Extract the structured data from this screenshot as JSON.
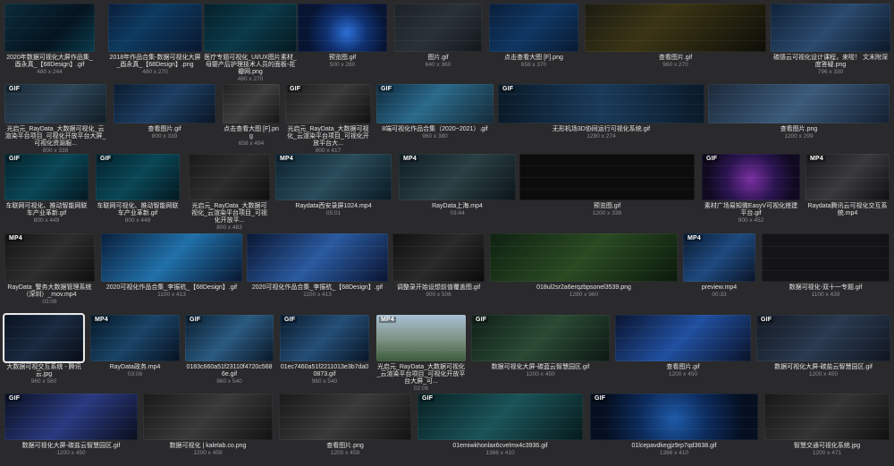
{
  "files": [
    {
      "id": "r1c1",
      "name": "2020年数据可视化大屏作品集_酉永真_【68Design】.gif",
      "dims": "480 x 244",
      "tag": "",
      "bg": "linear-gradient(135deg,#0b2b3b 0%,#05141f 60%,#0a3b4c 100%)"
    },
    {
      "id": "r1c2",
      "name": "2018年作品合集-数据可视化大屏_酉永真_【68Design】.png",
      "dims": "480 x 270",
      "tag": "",
      "bg": "linear-gradient(135deg,#0b1d3b 0%,#0d3b60 40%,#0a1730 100%)"
    },
    {
      "id": "r1c3",
      "name": "医疗专题可视化_UI/UX图片素材_母婴产后护理技术人员的面板-花瓣网.png",
      "dims": "480 x 270",
      "tag": "",
      "bg": "linear-gradient(135deg,#05202a 0%,#0b3a4a 50%,#041920 100%)"
    },
    {
      "id": "r1c4",
      "name": "预览图.gif",
      "dims": "500 x 280",
      "tag": "",
      "bg": "radial-gradient(circle at 55% 60%,#2b6fd6 0%,#103070 35%,#071432 70%)"
    },
    {
      "id": "r1c5",
      "name": "图片.gif",
      "dims": "640 x 360",
      "tag": "",
      "bg": "linear-gradient(135deg,#1c2228 0%,#2a3138 50%,#13181c 100%)"
    },
    {
      "id": "r1c6",
      "name": "点击查看大图 [F].png",
      "dims": "658 x 370",
      "tag": "",
      "bg": "linear-gradient(135deg,#0a1f3a 0%,#0f3763 50%,#081a31 100%)"
    },
    {
      "id": "r1c7",
      "name": "查看图片.gif",
      "dims": "960 x 270",
      "tag": "",
      "bg": "linear-gradient(135deg,#1b1b12 0%,#3b3515 40%,#0e0e08 100%)"
    },
    {
      "id": "r1c8",
      "name": "碳感云可视化设计课程，来啦！ 文末附深度答疑.png",
      "dims": "796 x 330",
      "tag": "",
      "bg": "linear-gradient(135deg,#0f2238 0%,#2b4a6e 50%,#0b1828 100%)"
    },
    {
      "id": "r2c1",
      "name": "光启元_RayData_大数据可视化_云渲染平台项目_可视化开放平台大屏_可视化资源服...",
      "dims": "800 x 338",
      "tag": "GIF",
      "bg": "linear-gradient(135deg,#1a2a36 0%,#2d4658 50%,#111c24 100%)"
    },
    {
      "id": "r2c2",
      "name": "查看图片.gif",
      "dims": "800 x 339",
      "tag": "",
      "bg": "linear-gradient(135deg,#0a1c2e 0%,#1d3e63 50%,#0a1523 100%)"
    },
    {
      "id": "r2c3",
      "name": "点击查看大图 [F].png",
      "dims": "658 x 494",
      "tag": "",
      "bg": "linear-gradient(135deg,#222 0%,#3e3e3e 50%,#151515 100%)"
    },
    {
      "id": "r2c4",
      "name": "光启元_RayData_大数据可视化_云渲染平台项目_可视化开放平台大...",
      "dims": "800 x 417",
      "tag": "GIF",
      "bg": "linear-gradient(135deg,#1e1e1e 0%,#3a3a3a 50%,#101010 100%)"
    },
    {
      "id": "r2c5",
      "name": "8端可视化作品合集（2020~2021）.gif",
      "dims": "960 x 380",
      "tag": "GIF",
      "bg": "linear-gradient(135deg,#0f2a3e 0%,#2a6a8a 45%,#152a38 100%)"
    },
    {
      "id": "r2c6",
      "name": "无形机场3D协同运行可视化系统.gif",
      "dims": "1290 x 274",
      "tag": "GIF",
      "bg": "linear-gradient(90deg,#0a1a28 0%,#1a3a5a 50%,#0a1a28 100%)"
    },
    {
      "id": "r2c7",
      "name": "查看图片.png",
      "dims": "1200 x 299",
      "tag": "",
      "bg": "linear-gradient(135deg,#1c2a3a 0%,#3b5a7a 50%,#142030 100%)"
    },
    {
      "id": "r3c1",
      "name": "车联网可视化、推动智能网联车产业革新.gif",
      "dims": "800 x 449",
      "tag": "GIF",
      "bg": "linear-gradient(135deg,#03222c 0%,#0a4756 50%,#031820 100%)"
    },
    {
      "id": "r3c2",
      "name": "车联网可视化、推动智能网联车产业革新.gif",
      "dims": "800 x 449",
      "tag": "GIF",
      "bg": "linear-gradient(135deg,#03222c 0%,#0a4756 50%,#031820 100%)"
    },
    {
      "id": "r3c3",
      "name": "光启元_RayData_大数据可视化_云渲染平台项目_可视化开放平...",
      "dims": "800 x 483",
      "tag": "",
      "bg": "linear-gradient(135deg,#1a1a1a 0%,#2d2d2d 50%,#0e0e0e 100%)"
    },
    {
      "id": "r3c4",
      "name": "Raydata西安录屏1024.mp4",
      "dims": "05:01",
      "tag": "MP4",
      "bg": "linear-gradient(135deg,#0c2230 0%,#2a4c5a 50%,#0a1a24 100%)"
    },
    {
      "id": "r3c5",
      "name": "RayData上海.mp4",
      "dims": "03:44",
      "tag": "MP4",
      "bg": "linear-gradient(135deg,#101e26 0%,#2a4044 50%,#0c1418 100%)"
    },
    {
      "id": "r3c6",
      "name": "预览图.gif",
      "dims": "1200 x 338",
      "tag": "",
      "bg": "#0c0c0c"
    },
    {
      "id": "r3c7",
      "name": "素材广场易知微EasyV可视化搭建平台.gif",
      "dims": "900 x 452",
      "tag": "GIF",
      "bg": "radial-gradient(circle at 50% 55%,#7a2fa0 0%,#2a1450 45%,#0f0a20 80%)"
    },
    {
      "id": "r3c8",
      "name": "Raydata腾讯云可视化交互系统.mp4",
      "dims": "",
      "tag": "MP4",
      "bg": "linear-gradient(135deg,#1a1a1c 0%,#3a3a3e 50%,#101012 100%)"
    },
    {
      "id": "r4c1",
      "name": "RayData_警务大数据管理系统（深圳）_mov.mp4",
      "dims": "03:08",
      "tag": "MP4",
      "bg": "linear-gradient(135deg,#141414 0%,#2e2e2e 50%,#0e0e0e 100%)"
    },
    {
      "id": "r4c2",
      "name": "2020可视化作品合集_李振杭_【68Design】.gif",
      "dims": "1100 x 413",
      "tag": "",
      "bg": "linear-gradient(135deg,#0a1e3a 0%,#2070a8 50%,#0a1630 100%)"
    },
    {
      "id": "r4c3",
      "name": "2020可视化作品合集_李振杭_【68Design】.gif",
      "dims": "1100 x 413",
      "tag": "",
      "bg": "linear-gradient(135deg,#0a1630 0%,#2a5aa0 50%,#0a1430 100%)"
    },
    {
      "id": "r4c4",
      "name": "调整录开始设想前值覆盖图.gif",
      "dims": "900 x 506",
      "tag": "",
      "bg": "linear-gradient(135deg,#111 0%,#2a2a2a 50%,#0a0a0a 100%)"
    },
    {
      "id": "r4c5",
      "name": "018ul2sr2a6erqzbpsonel3539.png",
      "dims": "1280 x 960",
      "tag": "",
      "bg": "linear-gradient(135deg,#0f2212 0%,#2a4a22 50%,#0c1a0c 100%)"
    },
    {
      "id": "r4c6",
      "name": "preview.mp4",
      "dims": "00:33",
      "tag": "MP4",
      "bg": "linear-gradient(135deg,#0a1a30 0%,#1e4a80 50%,#0a1428 100%)"
    },
    {
      "id": "r4c7",
      "name": "数据可视化-双十一专题.gif",
      "dims": "1100 x 439",
      "tag": "",
      "bg": "#141416"
    },
    {
      "id": "r5c1",
      "name": "大数据可视交互系统 - 腾讯云.jpg",
      "dims": "960 x 560",
      "tag": "",
      "bg": "linear-gradient(135deg,#0a1220 0%,#1a2a40 50%,#080e18 100%)",
      "selected": true
    },
    {
      "id": "r5c2",
      "name": "RayData政务.mp4",
      "dims": "03:08",
      "tag": "MP4",
      "bg": "linear-gradient(135deg,#061828 0%,#1a4468 50%,#061220 100%)"
    },
    {
      "id": "r5c3",
      "name": "0183c660a51f23110f4720c5686e.gif",
      "dims": "960 x 540",
      "tag": "GIF",
      "bg": "linear-gradient(135deg,#0a1e30 0%,#2a5a80 50%,#0a1828 100%)"
    },
    {
      "id": "r5c4",
      "name": "01ec7460a51f2211013e3b7da00873.gif",
      "dims": "960 x 540",
      "tag": "GIF",
      "bg": "linear-gradient(135deg,#0a1c2e 0%,#244e76 50%,#081626 100%)"
    },
    {
      "id": "r5c5",
      "name": "光启元_RayData_大数据可视化_云渲染平台项目_可视化开放平台大屏_可...",
      "dims": "02:06",
      "tag": "MP4",
      "bg": "linear-gradient(180deg,#a8c0d4 0%,#7a9080 55%,#3a5a3a 100%)"
    },
    {
      "id": "r5c6",
      "name": "数据可视化大屏-碳蓝云智慧园区.gif",
      "dims": "1200 x 450",
      "tag": "GIF",
      "bg": "linear-gradient(135deg,#102018 0%,#2a4a34 50%,#0c1812 100%)"
    },
    {
      "id": "r5c7",
      "name": "查看图片.gif",
      "dims": "1200 x 450",
      "tag": "",
      "bg": "linear-gradient(135deg,#0a1430 0%,#2050a0 50%,#0a1228 100%)"
    },
    {
      "id": "r5c8",
      "name": "数据可视化大屏-碳盐云智慧园区.gif",
      "dims": "1200 x 450",
      "tag": "GIF",
      "bg": "linear-gradient(135deg,#141a24 0%,#2a3a50 50%,#101620 100%)"
    },
    {
      "id": "r6c1",
      "name": "数据可视化大屏-碳盐云智慧园区.gif",
      "dims": "1200 x 450",
      "tag": "GIF",
      "bg": "linear-gradient(135deg,#0a1020 0%,#2a3a80 50%,#0a0e1c 100%)"
    },
    {
      "id": "r6c2",
      "name": "数据可视化 | kalelab.co.png",
      "dims": "1200 x 459",
      "tag": "",
      "bg": "linear-gradient(135deg,#1a1a1a 0%,#3a3a3a 50%,#121212 100%)"
    },
    {
      "id": "r6c3",
      "name": "查看图片.png",
      "dims": "1200 x 459",
      "tag": "",
      "bg": "linear-gradient(135deg,#1a1a1a 0%,#3a3a3a 50%,#121212 100%)"
    },
    {
      "id": "r6c4",
      "name": "01emiwkhonlax6cvelmx4c3936.gif",
      "dims": "1366 x 410",
      "tag": "GIF",
      "bg": "linear-gradient(135deg,#082024 0%,#1a5458 50%,#061a1c 100%)"
    },
    {
      "id": "r6c5",
      "name": "01lcepavdkegjz9rp7qd3638.gif",
      "dims": "1366 x 410",
      "tag": "GIF",
      "bg": "radial-gradient(circle at 50% 55%,#1e5aa8 0%,#0c2a5a 40%,#050f20 80%)"
    },
    {
      "id": "r6c6",
      "name": "智慧交通可视化系统.jpg",
      "dims": "1200 x 471",
      "tag": "",
      "bg": "linear-gradient(135deg,#181818 0%,#343434 50%,#101010 100%)"
    }
  ]
}
